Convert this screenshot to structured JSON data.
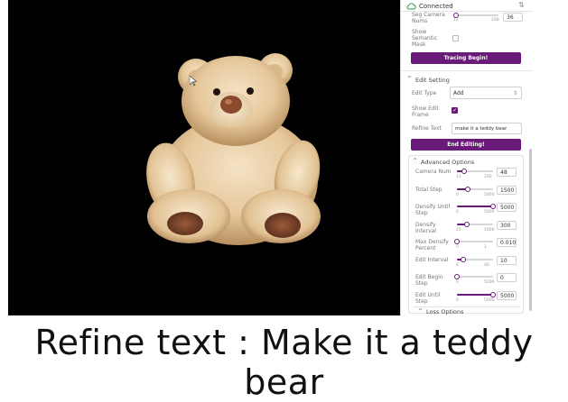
{
  "status": {
    "label": "Connected",
    "color": "#2e9e44"
  },
  "panel_top": {
    "partial_label": "Seg Camera Nums",
    "partial_value": "36",
    "partial_ticks": [
      "12",
      "200"
    ],
    "partial_fraction": 0.02,
    "semantic_mask_label": "Show Semantic Mask",
    "semantic_mask_checked": false,
    "tracing_button": "Tracing Begin!"
  },
  "edit_setting": {
    "title": "Edit Setting",
    "edit_type_label": "Edit Type",
    "edit_type_value": "Add",
    "show_edit_frame_label": "Show Edit Frame",
    "show_edit_frame_checked": true,
    "refine_text_label": "Refine Text",
    "refine_text_value": "make it a teddy bear",
    "end_button": "End Editing!"
  },
  "advanced": {
    "title": "Advanced Options",
    "params": [
      {
        "label": "Camera Num",
        "min": "12",
        "max": "200",
        "value": "48",
        "fraction": 0.19
      },
      {
        "label": "Total Step",
        "min": "0",
        "max": "5000",
        "value": "1500",
        "fraction": 0.3
      },
      {
        "label": "Densify Until Step",
        "min": "0",
        "max": "5000",
        "value": "5000",
        "fraction": 1.0
      },
      {
        "label": "Densify Interval",
        "min": "25",
        "max": "1000",
        "value": "300",
        "fraction": 0.28
      },
      {
        "label": "Max Densify Percent",
        "min": "0",
        "max": "1",
        "value": "0.010",
        "fraction": 0.01
      },
      {
        "label": "Edit Interval",
        "min": "4",
        "max": "40",
        "value": "10",
        "fraction": 0.17
      },
      {
        "label": "Edit Begin Step",
        "min": "0",
        "max": "5000",
        "value": "0",
        "fraction": 0.0
      },
      {
        "label": "Edit Until Step",
        "min": "0",
        "max": "5000",
        "value": "5000",
        "fraction": 1.0
      }
    ]
  },
  "loss": {
    "title": "Loss Options"
  },
  "caption": "Refine text : Make it a teddy bear",
  "colors": {
    "accent": "#6a1b7a",
    "viewport_bg": "#000000"
  }
}
